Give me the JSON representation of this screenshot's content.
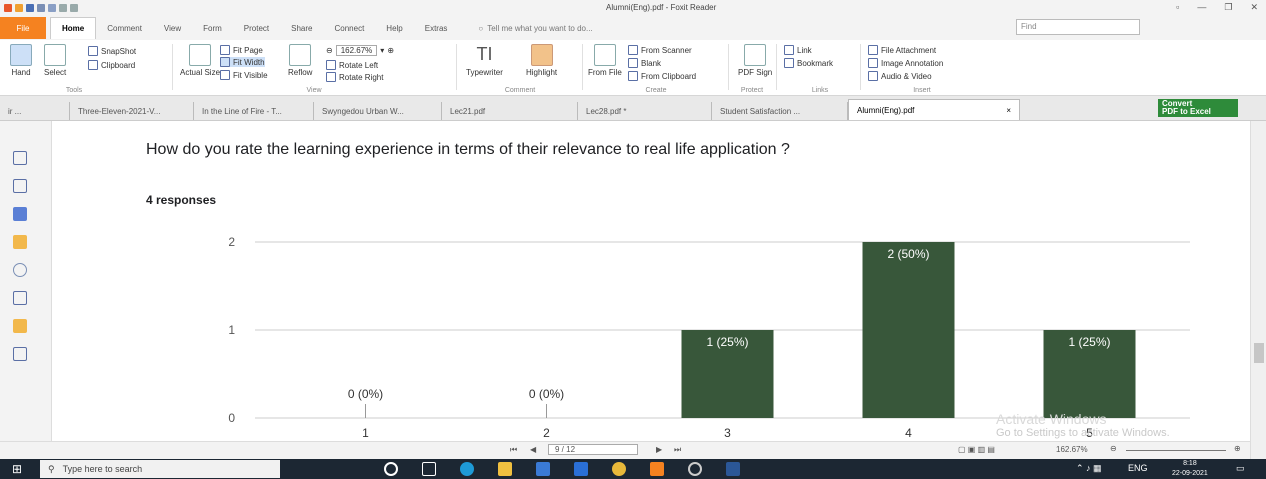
{
  "window": {
    "title": "Alumni(Eng).pdf - Foxit Reader",
    "find_placeholder": "Find"
  },
  "menu": {
    "file": "File",
    "items": [
      "Home",
      "Comment",
      "View",
      "Form",
      "Protect",
      "Share",
      "Connect",
      "Help",
      "Extras"
    ],
    "tell_me": "Tell me what you want to do..."
  },
  "ribbon": {
    "hand": "Hand",
    "select": "Select",
    "snapshot": "SnapShot",
    "clipboard": "Clipboard",
    "actual_size": "Actual Size",
    "fit_page": "Fit Page",
    "fit_width": "Fit Width",
    "fit_visible": "Fit Visible",
    "reflow": "Reflow",
    "zoom": "162.67%",
    "rotate_left": "Rotate Left",
    "rotate_right": "Rotate Right",
    "typewriter": "Typewriter",
    "highlight": "Highlight",
    "from_file": "From File",
    "from_scanner": "From Scanner",
    "blank": "Blank",
    "from_clipboard": "From Clipboard",
    "pdf_sign": "PDF Sign",
    "link": "Link",
    "bookmark": "Bookmark",
    "file_attachment": "File Attachment",
    "image_annotation": "Image Annotation",
    "audio_video": "Audio & Video",
    "groups": {
      "tools": "Tools",
      "view": "View",
      "comment": "Comment",
      "create": "Create",
      "protect": "Protect",
      "links": "Links",
      "insert": "Insert"
    }
  },
  "tabs": [
    "ir ...",
    "Three-Eleven-2021-V...",
    "In the Line of Fire - T...",
    "Swyngedou Urban W...",
    "Lec21.pdf",
    "Lec28.pdf *",
    "Student Satisfaction ...",
    "Alumni(Eng).pdf"
  ],
  "convert": {
    "line1": "Convert",
    "line2": "PDF to Excel"
  },
  "document": {
    "question": "How do you rate the learning experience in terms of their relevance to real life application ?",
    "responses": "4 responses"
  },
  "chart_data": {
    "type": "bar",
    "title": "How do you rate the learning experience in terms of their relevance to real life application ?",
    "categories": [
      "1",
      "2",
      "3",
      "4",
      "5"
    ],
    "values": [
      0,
      0,
      1,
      2,
      1
    ],
    "labels": [
      "0 (0%)",
      "0 (0%)",
      "1 (25%)",
      "2 (50%)",
      "1 (25%)"
    ],
    "yticks": [
      0,
      1,
      2
    ],
    "ylim": [
      0,
      2
    ],
    "bar_color": "#38573a",
    "grid": true
  },
  "watermark": {
    "line1": "Activate Windows",
    "line2": "Go to Settings to activate Windows."
  },
  "status": {
    "page": "9 / 12",
    "zoom": "162.67%"
  },
  "taskbar": {
    "search": "Type here to search",
    "lang": "ENG",
    "time": "8:18",
    "date": "22-09-2021"
  }
}
